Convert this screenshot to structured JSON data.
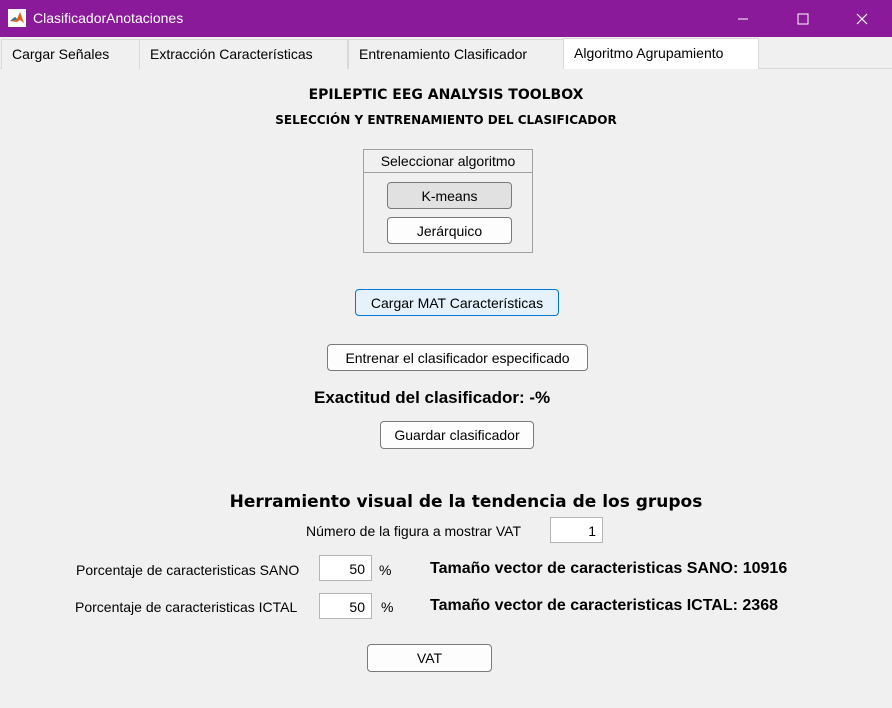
{
  "window": {
    "title": "ClasificadorAnotaciones",
    "icons": [
      "matlab-icon",
      "minimize-icon",
      "maximize-icon",
      "close-icon"
    ],
    "accent_color": "#8b1a9a"
  },
  "tabs": [
    {
      "label": "Cargar Señales"
    },
    {
      "label": "Extracción Características"
    },
    {
      "label": "Entrenamiento Clasificador"
    },
    {
      "label": "Algoritmo Agrupamiento"
    }
  ],
  "main": {
    "title": "EPILEPTIC EEG ANALYSIS TOOLBOX",
    "subtitle": "SELECCIÓN Y ENTRENAMIENTO DEL CLASIFICADOR",
    "algorithm_panel": {
      "title": "Seleccionar algoritmo",
      "options": [
        "K-means",
        "Jerárquico"
      ]
    },
    "load_button": "Cargar MAT Características",
    "train_button": "Entrenar el clasificador especificado",
    "accuracy_label": "Exactitud del clasificador: -%",
    "save_button": "Guardar clasificador"
  },
  "vat": {
    "title": "Herramiento visual de la tendencia de los grupos",
    "figure_label": "Número de la figura a mostrar VAT",
    "figure_value": "1",
    "sano_label": "Porcentaje de caracteristicas SANO",
    "sano_value": "50",
    "ictal_label": "Porcentaje de caracteristicas ICTAL",
    "ictal_value": "50",
    "percent_symbol": "%",
    "sano_size": "Tamaño vector de caracteristicas SANO: 10916",
    "ictal_size": "Tamaño vector de caracteristicas ICTAL: 2368",
    "vat_button": "VAT"
  }
}
